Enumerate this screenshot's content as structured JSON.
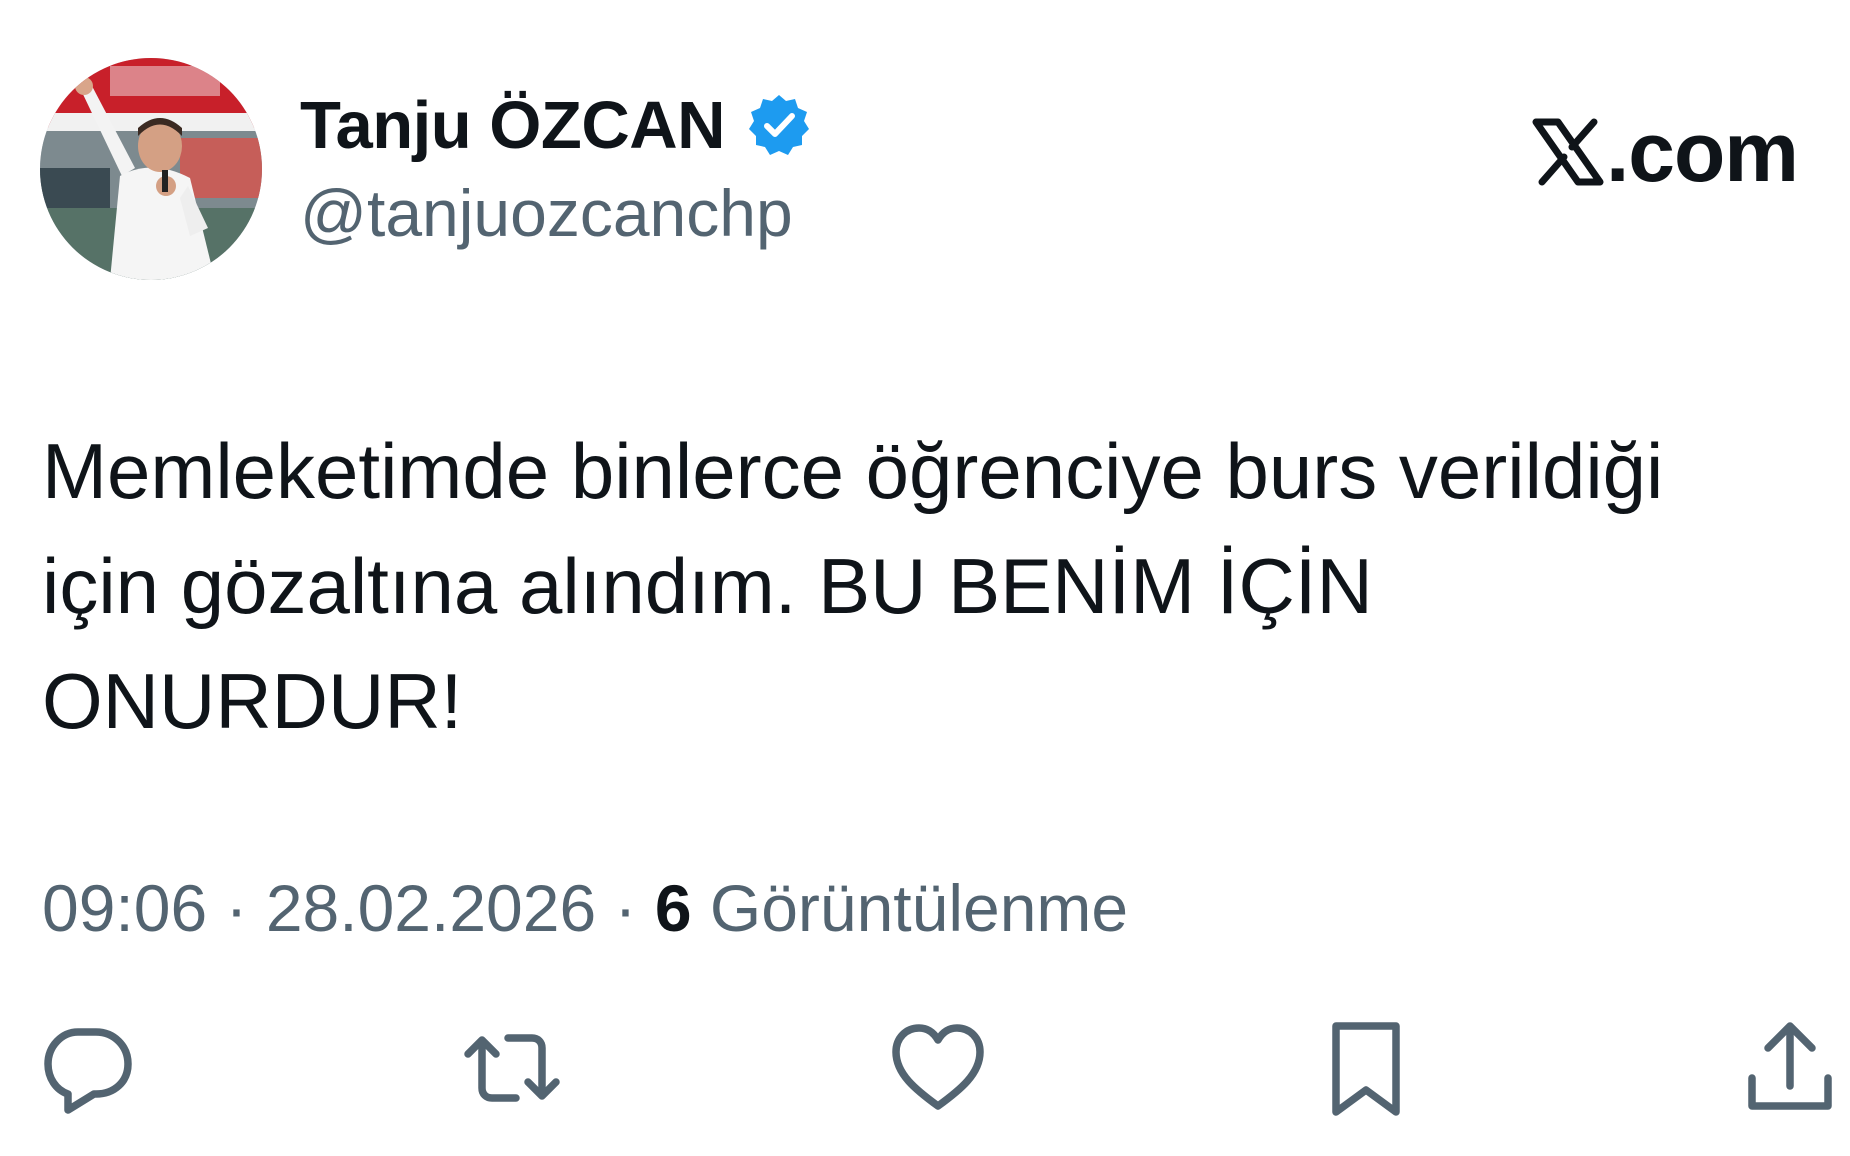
{
  "author": {
    "display_name": "Tanju ÖZCAN",
    "handle": "@tanjuozcanchp",
    "verified": true,
    "avatar": "profile-photo"
  },
  "brand": {
    "text": ".com",
    "icon": "x-logo-icon"
  },
  "tweet": {
    "text": "Memleketimde binlerce öğrenciye burs verildiği\niçin gözaltına alındım. BU BENİM İÇİN\nONURDUR!"
  },
  "meta": {
    "time": "09:06",
    "separator1": " · ",
    "date": "28.02.2026",
    "separator2": " · ",
    "views_count": "6",
    "views_label": " Görüntülenme"
  },
  "actions": [
    {
      "icon": "reply-icon"
    },
    {
      "icon": "retweet-icon"
    },
    {
      "icon": "like-icon"
    },
    {
      "icon": "bookmark-icon"
    },
    {
      "icon": "share-icon"
    }
  ],
  "colors": {
    "text_primary": "#0f1419",
    "text_secondary": "#536471",
    "verified_blue": "#1d9bf0",
    "icon_gray": "#536471"
  }
}
